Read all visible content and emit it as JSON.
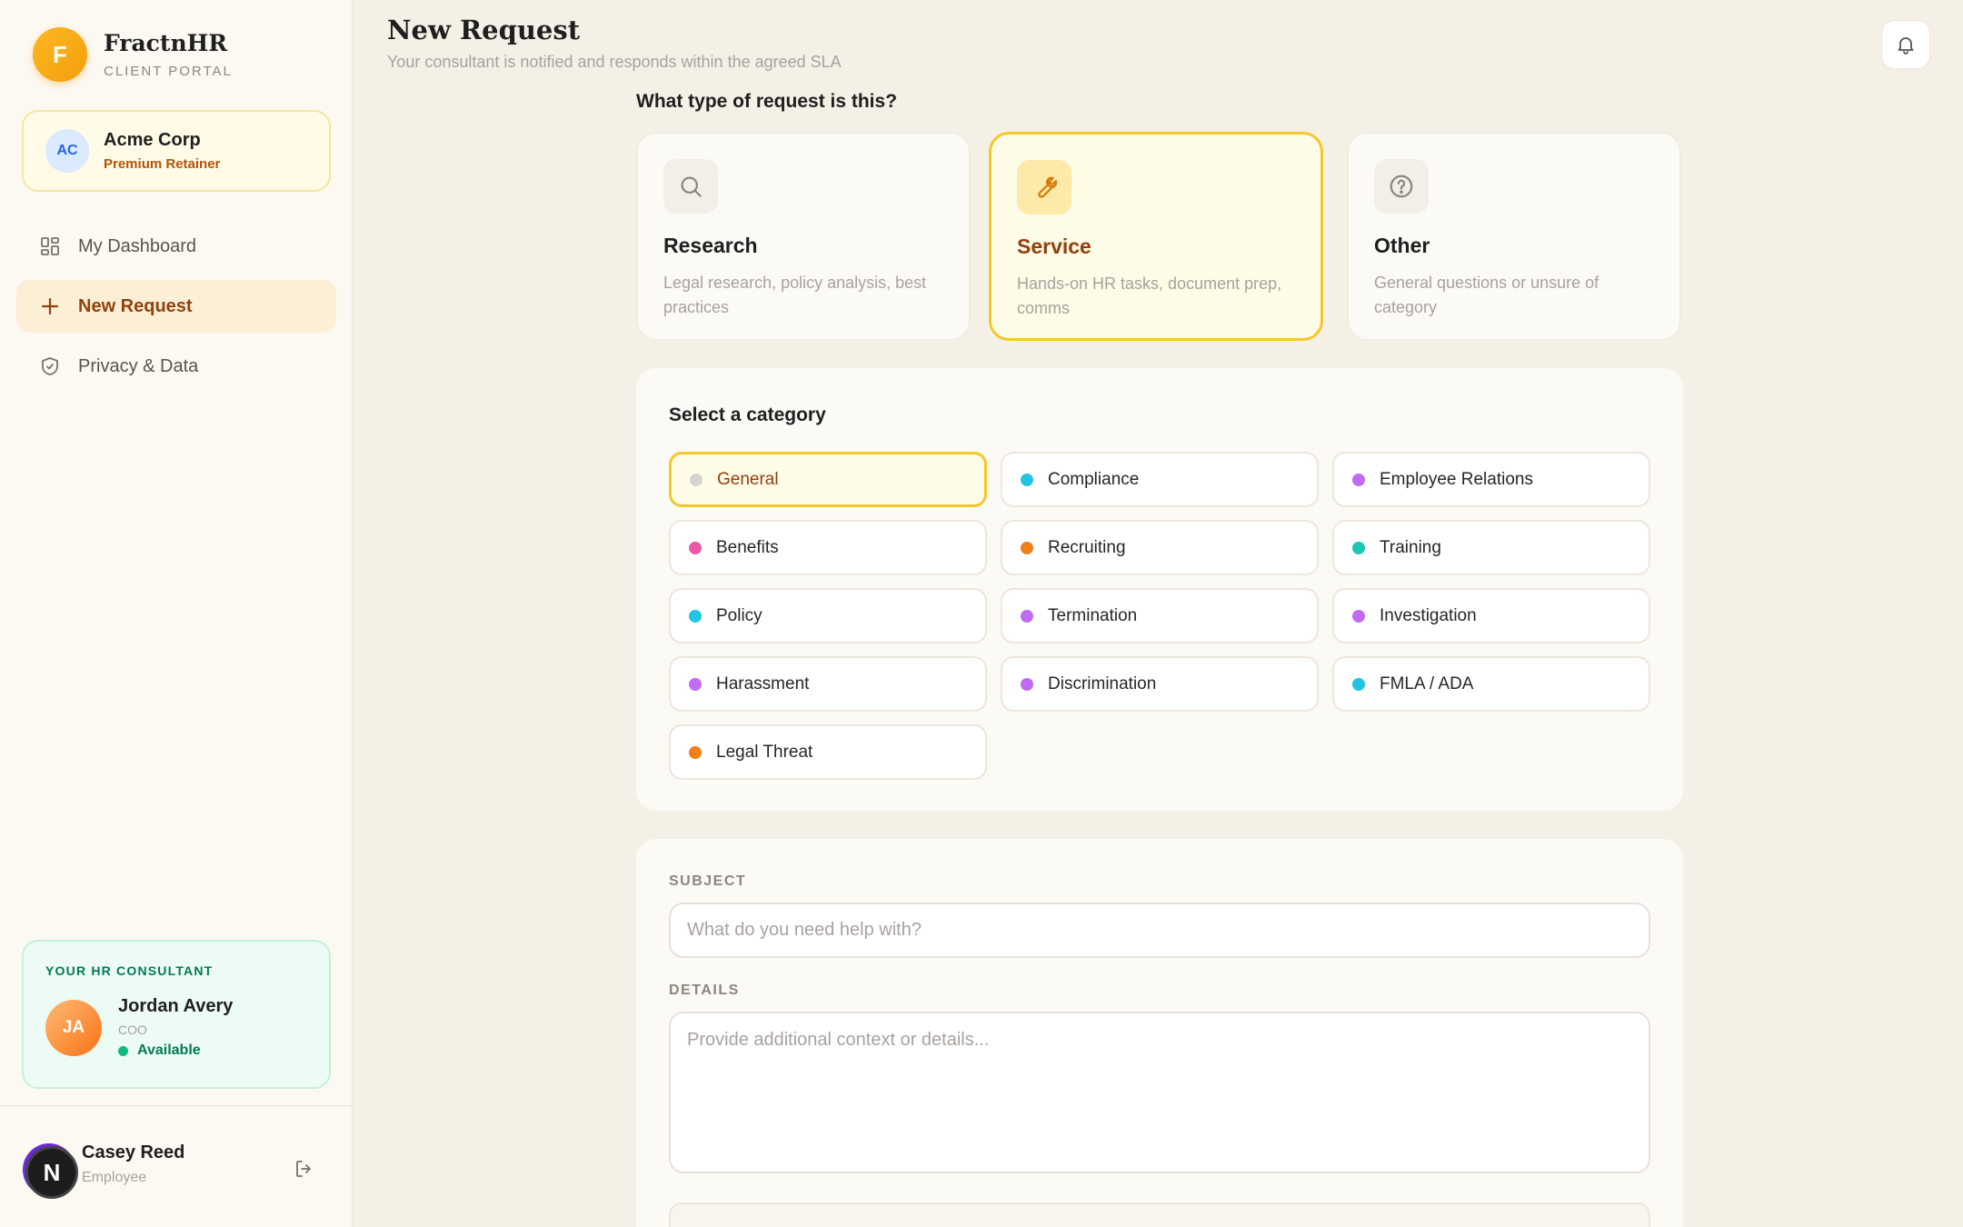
{
  "brand": {
    "logo_letter": "F",
    "name": "FractnHR",
    "subtitle": "CLIENT PORTAL",
    "accent": "#f59e0b"
  },
  "org": {
    "initials": "AC",
    "name": "Acme Corp",
    "plan": "Premium Retainer"
  },
  "nav": {
    "items": [
      {
        "label": "My Dashboard",
        "icon": "grid-icon",
        "active": false
      },
      {
        "label": "New Request",
        "icon": "plus-icon",
        "active": true
      },
      {
        "label": "Privacy & Data",
        "icon": "shield-icon",
        "active": false
      }
    ]
  },
  "consultant": {
    "heading": "YOUR HR CONSULTANT",
    "initials": "JA",
    "name": "Jordan Avery",
    "role": "COO",
    "status": "Available"
  },
  "user": {
    "avatar_letter": "N",
    "name": "Casey Reed",
    "role": "Employee"
  },
  "header": {
    "title": "New Request",
    "subtitle": "Your consultant is notified and responds within the agreed SLA"
  },
  "request_type": {
    "question": "What type of request is this?",
    "options": [
      {
        "title": "Research",
        "description": "Legal research, policy analysis, best practices",
        "icon": "search-icon",
        "selected": false
      },
      {
        "title": "Service",
        "description": "Hands-on HR tasks, document prep, comms",
        "icon": "wrench-icon",
        "selected": true
      },
      {
        "title": "Other",
        "description": "General questions or unsure of category",
        "icon": "question-icon",
        "selected": false
      }
    ]
  },
  "category": {
    "heading": "Select a category",
    "items": [
      {
        "label": "General",
        "color": "#d6d3d1",
        "selected": true
      },
      {
        "label": "Compliance",
        "color": "#22c5e0",
        "selected": false
      },
      {
        "label": "Employee Relations",
        "color": "#c06cf0",
        "selected": false
      },
      {
        "label": "Benefits",
        "color": "#ec5aa6",
        "selected": false
      },
      {
        "label": "Recruiting",
        "color": "#f07f1a",
        "selected": false
      },
      {
        "label": "Training",
        "color": "#1ec7b4",
        "selected": false
      },
      {
        "label": "Policy",
        "color": "#22c5e0",
        "selected": false
      },
      {
        "label": "Termination",
        "color": "#c06cf0",
        "selected": false
      },
      {
        "label": "Investigation",
        "color": "#c06cf0",
        "selected": false
      },
      {
        "label": "Harassment",
        "color": "#c06cf0",
        "selected": false
      },
      {
        "label": "Discrimination",
        "color": "#c06cf0",
        "selected": false
      },
      {
        "label": "FMLA / ADA",
        "color": "#22c5e0",
        "selected": false
      },
      {
        "label": "Legal Threat",
        "color": "#f07f1a",
        "selected": false
      }
    ]
  },
  "form": {
    "subject_label": "SUBJECT",
    "subject_placeholder": "What do you need help with?",
    "subject_value": "",
    "details_label": "DETAILS",
    "details_placeholder": "Provide additional context or details...",
    "details_value": ""
  }
}
